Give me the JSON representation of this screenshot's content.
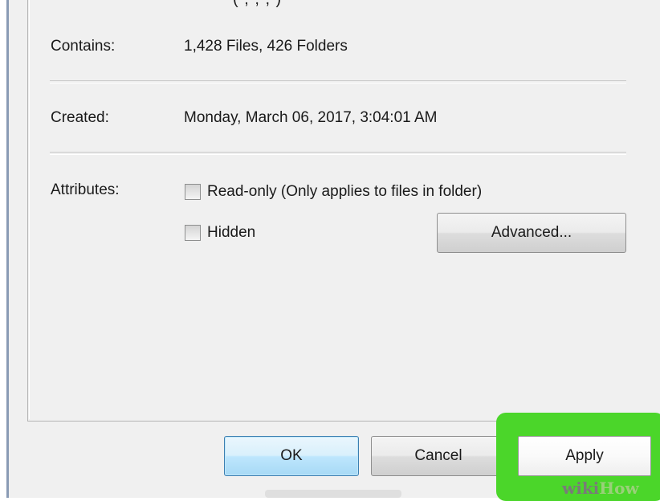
{
  "properties": {
    "clipped_top_text": "(   ,   ,   ,   )",
    "contains_label": "Contains:",
    "contains_value": "1,428 Files, 426 Folders",
    "created_label": "Created:",
    "created_value": "Monday, March 06, 2017, 3:04:01 AM",
    "attributes_label": "Attributes:",
    "readonly_label": "Read-only (Only applies to files in folder)",
    "readonly_checked": "indeterminate",
    "hidden_label": "Hidden",
    "hidden_checked": false,
    "advanced_label": "Advanced..."
  },
  "footer": {
    "ok_label": "OK",
    "cancel_label": "Cancel",
    "apply_label": "Apply"
  },
  "watermark": {
    "part1": "wiki",
    "part2": "How"
  },
  "colors": {
    "highlight": "#4bd62a",
    "dialog_bg": "#f0f0f0",
    "ok_border": "#3c7fb1"
  }
}
